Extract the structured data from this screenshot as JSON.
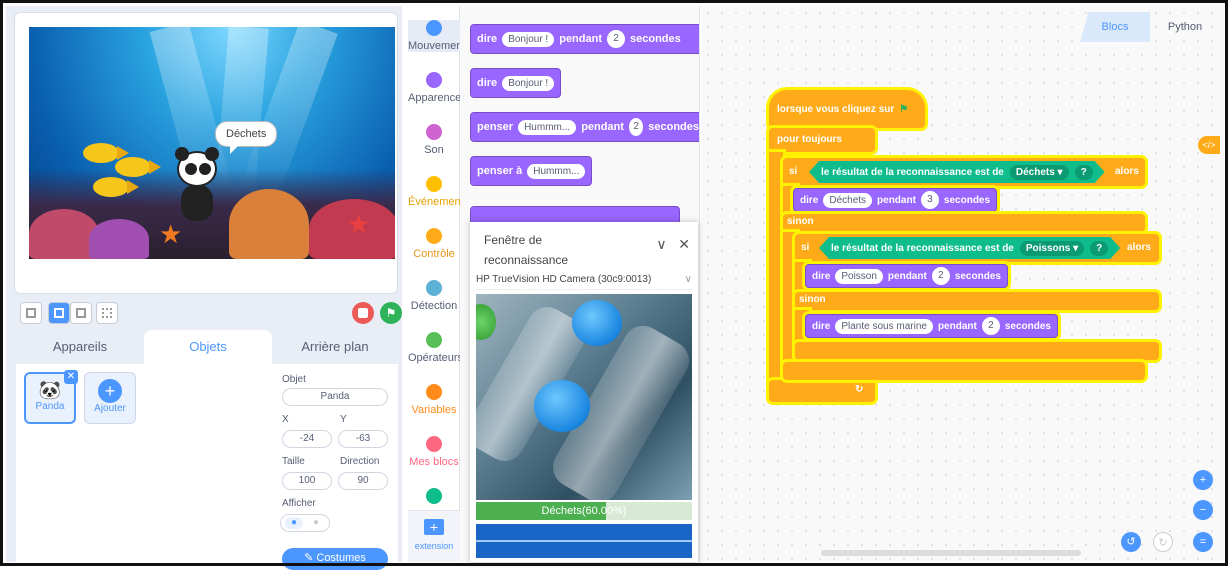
{
  "stage": {
    "speech": "Déchets"
  },
  "tabs": {
    "devices": "Appareils",
    "sprites": "Objets",
    "backdrop": "Arrière plan"
  },
  "sprites": [
    {
      "name": "Panda"
    },
    {
      "name": "Ajouter"
    }
  ],
  "props": {
    "object_label": "Objet",
    "object_value": "Panda",
    "x_label": "X",
    "x_value": "-24",
    "y_label": "Y",
    "y_value": "-63",
    "size_label": "Taille",
    "size_value": "100",
    "dir_label": "Direction",
    "dir_value": "90",
    "show_label": "Afficher",
    "costumes_label": "Costumes"
  },
  "categories": [
    {
      "label": "Mouvement",
      "color": "#4c97ff"
    },
    {
      "label": "Apparence",
      "color": "#9966ff"
    },
    {
      "label": "Son",
      "color": "#cf63cf"
    },
    {
      "label": "Événements",
      "color": "#ffbf00"
    },
    {
      "label": "Contrôle",
      "color": "#ffab19"
    },
    {
      "label": "Détection",
      "color": "#5cb1d6"
    },
    {
      "label": "Opérateurs",
      "color": "#59c059"
    },
    {
      "label": "Variables",
      "color": "#ff8c1a"
    },
    {
      "label": "Mes blocs",
      "color": "#ff6680"
    },
    {
      "label": "",
      "color": "#0fbd8c"
    }
  ],
  "extension_label": "extension",
  "palette": {
    "b1": {
      "say": "dire",
      "text": "Bonjour !",
      "for": "pendant",
      "num": "2",
      "secs": "secondes"
    },
    "b2": {
      "say": "dire",
      "text": "Bonjour !"
    },
    "b3": {
      "think": "penser",
      "text": "Hummm...",
      "for": "pendant",
      "num": "2",
      "secs": "secondes"
    },
    "b4": {
      "think": "penser à",
      "text": "Hummm..."
    }
  },
  "recognition": {
    "title": "Fenêtre de reconnaissance",
    "camera": "HP TrueVision HD Camera (30c9:0013)",
    "result": "Déchets(60.00%)",
    "confidence": 0.6
  },
  "workspace": {
    "tab_blocks": "Blocs",
    "tab_python": "Python",
    "code_icon": "</>",
    "hat": "lorsque vous cliquez sur",
    "forever": "pour toujours",
    "if1": "si",
    "cond1": "le résultat de la reconnaissance est de",
    "cond1_val": "Déchets ▾",
    "q": "?",
    "then": "alors",
    "say1": {
      "say": "dire",
      "text": "Déchets",
      "for": "pendant",
      "num": "3",
      "secs": "secondes"
    },
    "else1": "sinon",
    "if2": "si",
    "cond2": "le résultat de la reconnaissance est de",
    "cond2_val": "Poissons ▾",
    "say2": {
      "say": "dire",
      "text": "Poisson",
      "for": "pendant",
      "num": "2",
      "secs": "secondes"
    },
    "else2": "sinon",
    "say3": {
      "say": "dire",
      "text": "Plante sous marine",
      "for": "pendant",
      "num": "2",
      "secs": "secondes"
    }
  }
}
